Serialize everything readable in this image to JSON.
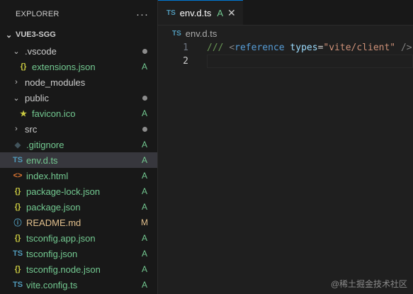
{
  "sidebar": {
    "title": "EXPLORER",
    "more": "···",
    "root": {
      "chevron": "⌄",
      "label": "VUE3-SGG"
    },
    "items": [
      {
        "name": ".vscode",
        "type": "folder",
        "open": true,
        "indent": 1,
        "status": "dot",
        "chevron": "⌄",
        "icon": ""
      },
      {
        "name": "extensions.json",
        "type": "json",
        "indent": 2,
        "status": "A",
        "icon": "{}",
        "iconColor": "#cbcb41"
      },
      {
        "name": "node_modules",
        "type": "folder",
        "open": false,
        "indent": 1,
        "status": "",
        "chevron": "›",
        "icon": ""
      },
      {
        "name": "public",
        "type": "folder",
        "open": true,
        "indent": 1,
        "status": "dot",
        "chevron": "⌄",
        "icon": ""
      },
      {
        "name": "favicon.ico",
        "type": "ico",
        "indent": 2,
        "status": "A",
        "icon": "★",
        "iconColor": "#cbcb41"
      },
      {
        "name": "src",
        "type": "folder",
        "open": false,
        "indent": 1,
        "status": "dot",
        "chevron": "›",
        "icon": ""
      },
      {
        "name": ".gitignore",
        "type": "git",
        "indent": 1,
        "status": "A",
        "icon": "◆",
        "iconColor": "#41535b"
      },
      {
        "name": "env.d.ts",
        "type": "ts",
        "indent": 1,
        "status": "A",
        "icon": "TS",
        "iconColor": "#519aba",
        "selected": true
      },
      {
        "name": "index.html",
        "type": "html",
        "indent": 1,
        "status": "A",
        "icon": "<>",
        "iconColor": "#e37933"
      },
      {
        "name": "package-lock.json",
        "type": "json",
        "indent": 1,
        "status": "A",
        "icon": "{}",
        "iconColor": "#cbcb41"
      },
      {
        "name": "package.json",
        "type": "json",
        "indent": 1,
        "status": "A",
        "icon": "{}",
        "iconColor": "#cbcb41"
      },
      {
        "name": "README.md",
        "type": "md",
        "indent": 1,
        "status": "M",
        "icon": "ⓘ",
        "iconColor": "#519aba"
      },
      {
        "name": "tsconfig.app.json",
        "type": "json",
        "indent": 1,
        "status": "A",
        "icon": "{}",
        "iconColor": "#cbcb41"
      },
      {
        "name": "tsconfig.json",
        "type": "tsconfig",
        "indent": 1,
        "status": "A",
        "icon": "TS",
        "iconColor": "#519aba"
      },
      {
        "name": "tsconfig.node.json",
        "type": "json",
        "indent": 1,
        "status": "A",
        "icon": "{}",
        "iconColor": "#cbcb41"
      },
      {
        "name": "vite.config.ts",
        "type": "ts",
        "indent": 1,
        "status": "A",
        "icon": "TS",
        "iconColor": "#519aba"
      }
    ]
  },
  "tab": {
    "icon": "TS",
    "name": "env.d.ts",
    "badge": "A",
    "close": "✕"
  },
  "breadcrumb": {
    "icon": "TS",
    "name": "env.d.ts"
  },
  "code": {
    "lines": [
      {
        "number": "1",
        "slash": "///",
        "open": "<",
        "tag": "reference",
        "attr": "types",
        "eq": "=",
        "value": "\"vite/client\"",
        "close": "/>"
      },
      {
        "number": "2"
      }
    ]
  },
  "watermark": "@稀土掘金技术社区",
  "colors": {
    "accent": "#0078d4",
    "added": "#73c991",
    "modified": "#e2c08d",
    "selection": "#37373d"
  }
}
